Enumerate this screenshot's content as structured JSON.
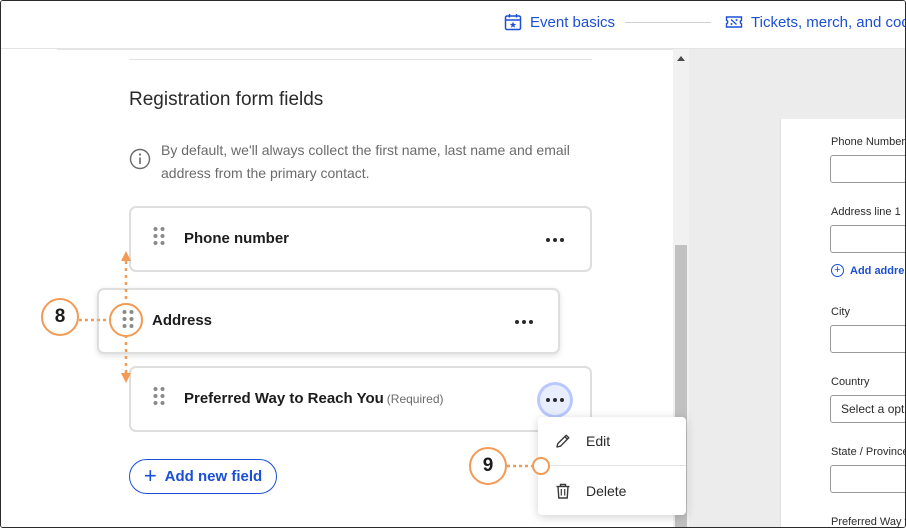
{
  "steps": [
    {
      "label": "Event basics",
      "icon": "calendar-star-icon"
    },
    {
      "label": "Tickets, merch, and codes",
      "icon": "ticket-icon"
    }
  ],
  "section": {
    "title": "Registration form fields",
    "info": "By default, we'll always collect the first name, last name and email address from the primary contact."
  },
  "fields": [
    {
      "label": "Phone number",
      "required": ""
    },
    {
      "label": "Address",
      "required": ""
    },
    {
      "label": "Preferred Way to Reach You",
      "required": "(Required)"
    }
  ],
  "add_field_label": "Add new field",
  "menu": [
    {
      "label": "Edit",
      "icon": "pencil-icon"
    },
    {
      "label": "Delete",
      "icon": "trash-icon"
    }
  ],
  "preview": {
    "phone_label": "Phone Number",
    "address_label": "Address line 1",
    "add_address_link": "Add address",
    "city_label": "City",
    "country_label": "Country",
    "country_value": "Select a option",
    "state_label": "State / Province",
    "preferred_label": "Preferred Way to"
  },
  "callouts": {
    "first": "8",
    "second": "9"
  },
  "colors": {
    "accent": "#1a4fd6",
    "callout": "#f39a54"
  }
}
